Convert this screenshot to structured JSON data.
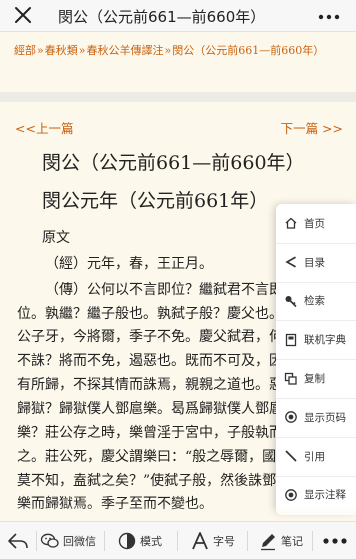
{
  "topbar": {
    "title": "閔公（公元前661—前660年）"
  },
  "breadcrumb": {
    "items": [
      "經部",
      "春秋類",
      "春秋公羊傳譯注",
      "閔公（公元前661—前660年）"
    ],
    "separator": "»"
  },
  "nav": {
    "prev": "<<上一篇",
    "next": "下一篇 >>"
  },
  "content": {
    "heading1": "閔公（公元前661—前660年）",
    "heading2": "閔公元年（公元前661年）",
    "section_label": "原文",
    "lines": [
      "（經）元年，春，王正月。",
      "（傳）公何以不言即位？繼弑君不言即",
      "位。孰繼？繼子般也。孰弑子般？慶父也。殺",
      "公子牙，今將爾，季子不免。慶父弑君，何以",
      "不誅？將而不免，遏惡也。既而不可及，因獄",
      "有所歸，不探其情而誅焉，親親之道也。惡乎",
      "歸獄？歸獄僕人鄧扈樂。曷爲歸獄僕人鄧扈",
      "樂？莊公存之時，樂曾淫于宮中，子般執而鞭",
      "之。莊公死，慶父謂樂曰：“般之辱爾，國人",
      "莫不知，盍弑之矣？”使弑子般，然後誅鄧扈",
      "樂而歸獄焉。季子至而不變也。"
    ]
  },
  "side_menu": {
    "items": [
      {
        "label": "首页",
        "icon": "home-icon"
      },
      {
        "label": "目录",
        "icon": "share-icon"
      },
      {
        "label": "检索",
        "icon": "key-icon"
      },
      {
        "label": "联机字典",
        "icon": "dictionary-icon"
      },
      {
        "label": "复制",
        "icon": "copy-icon"
      },
      {
        "label": "显示页码",
        "icon": "target-icon"
      },
      {
        "label": "引用",
        "icon": "pencil-icon"
      },
      {
        "label": "显示注释",
        "icon": "target-icon"
      }
    ]
  },
  "toolbar": {
    "back_icon": "back-arrow-icon",
    "wechat_label": "回微信",
    "mode_label": "模式",
    "font_label": "字号",
    "notes_label": "笔记",
    "more_icon": "more-icon"
  },
  "colors": {
    "accent": "#c9620f",
    "background": "#fdf8ec",
    "menu_bg": "#ffffff"
  }
}
